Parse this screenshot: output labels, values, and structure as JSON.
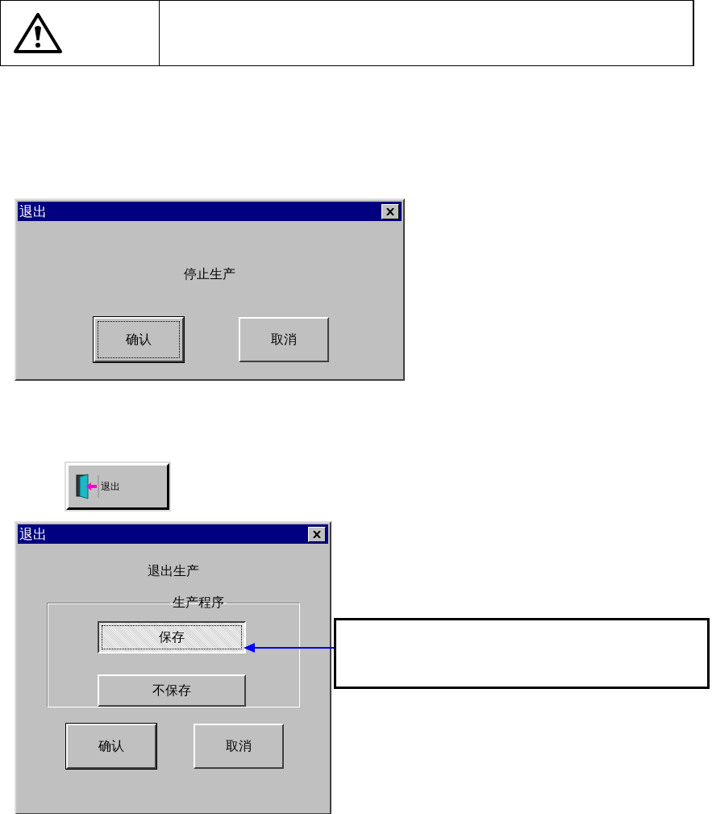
{
  "dialogs": [
    {
      "title": "退出",
      "message": "停止生产",
      "buttons": [
        {
          "label": "确认",
          "default": true,
          "focused": true
        },
        {
          "label": "取消",
          "default": false,
          "focused": false
        }
      ]
    },
    {
      "title": "退出",
      "message": "退出生产",
      "group": {
        "label": "生产程序",
        "buttons": [
          {
            "label": "保存",
            "default": false,
            "focused": true
          },
          {
            "label": "不保存",
            "default": false,
            "focused": false
          }
        ]
      },
      "buttons": [
        {
          "label": "确认",
          "default": true,
          "focused": false
        },
        {
          "label": "取消",
          "default": false,
          "focused": false
        }
      ]
    }
  ],
  "exit_button": {
    "label": "退出"
  }
}
